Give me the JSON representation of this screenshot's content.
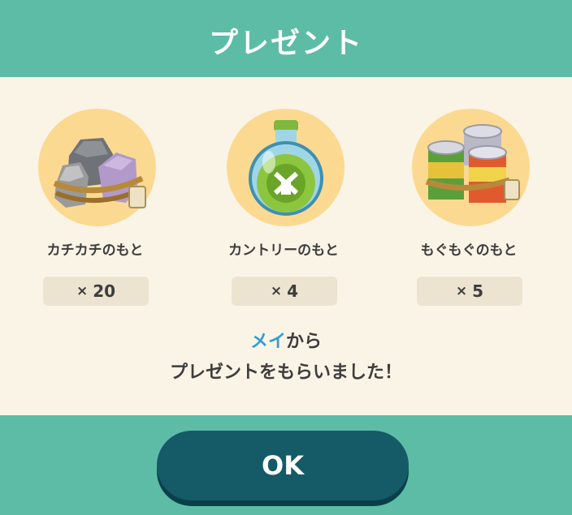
{
  "dialog": {
    "title": "プレゼント",
    "items": [
      {
        "name": "カチカチのもと",
        "qty_prefix": "×",
        "qty": "20",
        "icon": "stone-bundle-icon"
      },
      {
        "name": "カントリーのもと",
        "qty_prefix": "×",
        "qty": "4",
        "icon": "green-potion-flask-icon"
      },
      {
        "name": "もぐもぐのもと",
        "qty_prefix": "×",
        "qty": "5",
        "icon": "canned-food-bundle-icon"
      }
    ],
    "message": {
      "sender": "メイ",
      "line1_suffix": "から",
      "line2": "プレゼントをもらいました！"
    },
    "ok_label": "OK"
  },
  "colors": {
    "header_bg": "#5dbca6",
    "panel_bg": "#faf4e6",
    "icon_circle": "#fbd991",
    "qty_bg": "#ece3d1",
    "sender_text": "#2f9ed8",
    "button_bg": "#145b67"
  }
}
